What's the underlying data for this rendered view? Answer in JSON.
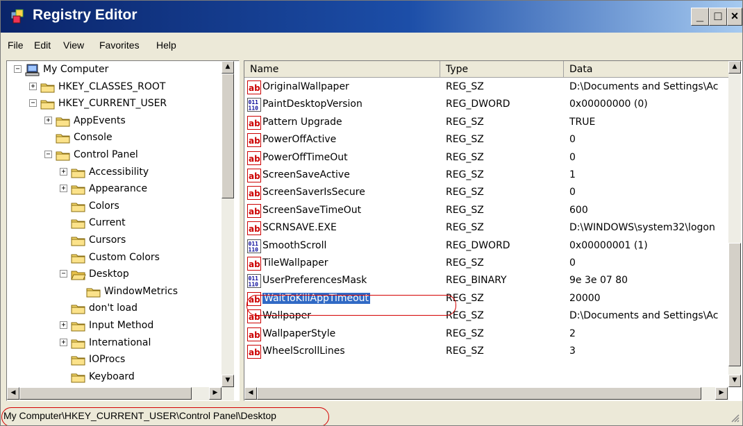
{
  "window": {
    "title": "Registry Editor",
    "buttons": {
      "min": "_",
      "max": "□",
      "close": "×"
    }
  },
  "menu": [
    "File",
    "Edit",
    "View",
    "Favorites",
    "Help"
  ],
  "tree": [
    {
      "label": "My Computer",
      "toggle": "−",
      "icon": "computer-icon"
    },
    {
      "label": "HKEY_CLASSES_ROOT",
      "toggle": "+",
      "icon": "folder-icon"
    },
    {
      "label": "HKEY_CURRENT_USER",
      "toggle": "−",
      "icon": "folder-icon"
    },
    {
      "label": "AppEvents",
      "toggle": "+",
      "icon": "folder-icon"
    },
    {
      "label": "Console",
      "toggle": "",
      "icon": "folder-icon"
    },
    {
      "label": "Control Panel",
      "toggle": "−",
      "icon": "folder-icon"
    },
    {
      "label": "Accessibility",
      "toggle": "+",
      "icon": "folder-icon"
    },
    {
      "label": "Appearance",
      "toggle": "+",
      "icon": "folder-icon"
    },
    {
      "label": "Colors",
      "toggle": "",
      "icon": "folder-icon"
    },
    {
      "label": "Current",
      "toggle": "",
      "icon": "folder-icon"
    },
    {
      "label": "Cursors",
      "toggle": "",
      "icon": "folder-icon"
    },
    {
      "label": "Custom Colors",
      "toggle": "",
      "icon": "folder-icon"
    },
    {
      "label": "Desktop",
      "toggle": "−",
      "icon": "open-folder-icon"
    },
    {
      "label": "WindowMetrics",
      "toggle": "",
      "icon": "folder-icon"
    },
    {
      "label": "don't load",
      "toggle": "",
      "icon": "folder-icon"
    },
    {
      "label": "Input Method",
      "toggle": "+",
      "icon": "folder-icon"
    },
    {
      "label": "International",
      "toggle": "+",
      "icon": "folder-icon"
    },
    {
      "label": "IOProcs",
      "toggle": "",
      "icon": "folder-icon"
    },
    {
      "label": "Keyboard",
      "toggle": "",
      "icon": "folder-icon"
    }
  ],
  "list": {
    "columns": [
      "Name",
      "Type",
      "Data"
    ],
    "rows": [
      {
        "name": "OriginalWallpaper",
        "type": "REG_SZ",
        "data": "D:\\Documents and Settings\\Ac",
        "icon": "string-value-icon"
      },
      {
        "name": "PaintDesktopVersion",
        "type": "REG_DWORD",
        "data": "0x00000000 (0)",
        "icon": "binary-value-icon"
      },
      {
        "name": "Pattern Upgrade",
        "type": "REG_SZ",
        "data": "TRUE",
        "icon": "string-value-icon"
      },
      {
        "name": "PowerOffActive",
        "type": "REG_SZ",
        "data": "0",
        "icon": "string-value-icon"
      },
      {
        "name": "PowerOffTimeOut",
        "type": "REG_SZ",
        "data": "0",
        "icon": "string-value-icon"
      },
      {
        "name": "ScreenSaveActive",
        "type": "REG_SZ",
        "data": "1",
        "icon": "string-value-icon"
      },
      {
        "name": "ScreenSaverIsSecure",
        "type": "REG_SZ",
        "data": "0",
        "icon": "string-value-icon"
      },
      {
        "name": "ScreenSaveTimeOut",
        "type": "REG_SZ",
        "data": "600",
        "icon": "string-value-icon"
      },
      {
        "name": "SCRNSAVE.EXE",
        "type": "REG_SZ",
        "data": "D:\\WINDOWS\\system32\\logon",
        "icon": "string-value-icon"
      },
      {
        "name": "SmoothScroll",
        "type": "REG_DWORD",
        "data": "0x00000001 (1)",
        "icon": "binary-value-icon"
      },
      {
        "name": "TileWallpaper",
        "type": "REG_SZ",
        "data": "0",
        "icon": "string-value-icon"
      },
      {
        "name": "UserPreferencesMask",
        "type": "REG_BINARY",
        "data": "9e 3e 07 80",
        "icon": "binary-value-icon"
      },
      {
        "name": "WaitToKillAppTimeout",
        "type": "REG_SZ",
        "data": "20000",
        "icon": "string-value-icon",
        "selected": true
      },
      {
        "name": "Wallpaper",
        "type": "REG_SZ",
        "data": "D:\\Documents and Settings\\Ac",
        "icon": "string-value-icon"
      },
      {
        "name": "WallpaperStyle",
        "type": "REG_SZ",
        "data": "2",
        "icon": "string-value-icon"
      },
      {
        "name": "WheelScrollLines",
        "type": "REG_SZ",
        "data": "3",
        "icon": "string-value-icon"
      }
    ]
  },
  "status": {
    "path": "My Computer\\HKEY_CURRENT_USER\\Control Panel\\Desktop"
  },
  "colors": {
    "title_start": "#0a246a",
    "title_end": "#a6caf0",
    "selection": "#316ac5",
    "highlight_oval": "#d40000"
  }
}
